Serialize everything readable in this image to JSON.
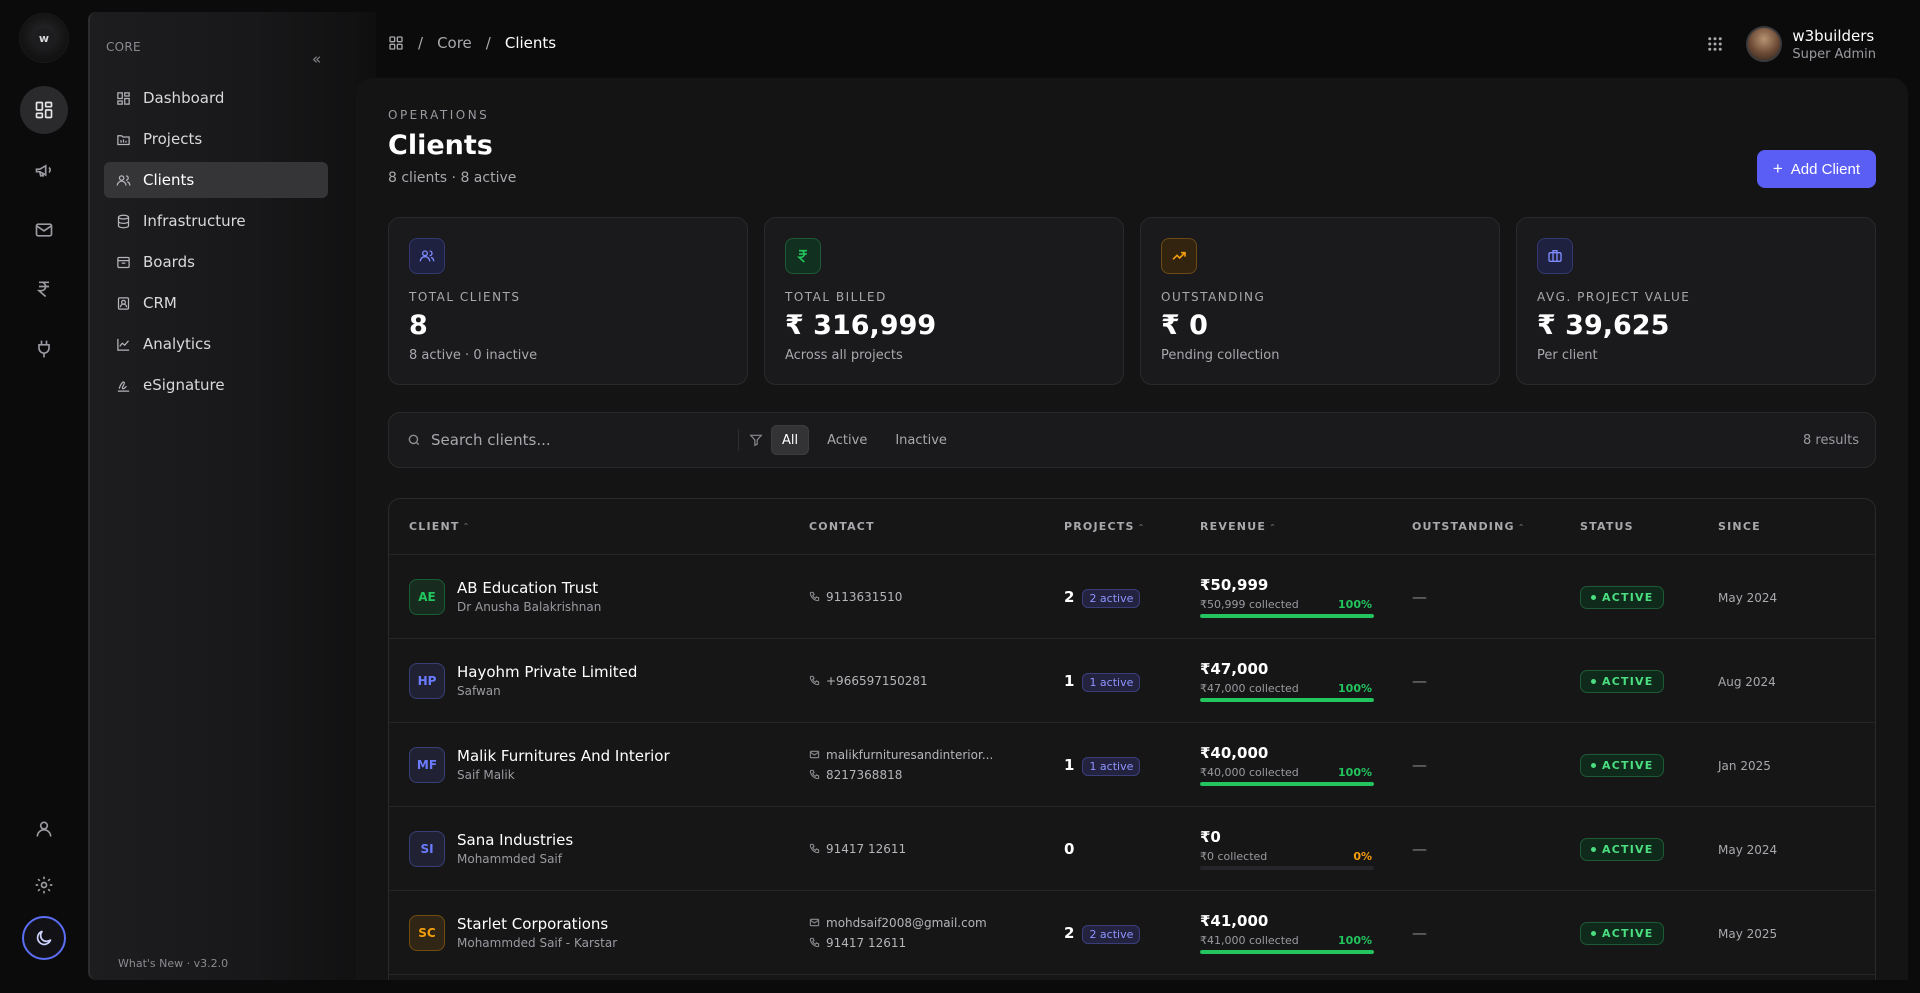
{
  "rail": {
    "logo_letter": "w",
    "items": [
      {
        "name": "dashboard-grid-icon",
        "active": true
      },
      {
        "name": "megaphone-icon",
        "active": false
      },
      {
        "name": "mail-icon",
        "active": false
      },
      {
        "name": "rupee-icon",
        "active": false
      },
      {
        "name": "plug-icon",
        "active": false
      }
    ],
    "bottom": [
      "user-icon",
      "settings-icon",
      "moon-icon"
    ]
  },
  "sidenav": {
    "section_label": "CORE",
    "collapse_icon": "«",
    "items": [
      {
        "label": "Dashboard",
        "icon": "dashboard-icon"
      },
      {
        "label": "Projects",
        "icon": "projects-icon"
      },
      {
        "label": "Clients",
        "icon": "users-icon",
        "active": true
      },
      {
        "label": "Infrastructure",
        "icon": "database-icon"
      },
      {
        "label": "Boards",
        "icon": "boards-icon"
      },
      {
        "label": "CRM",
        "icon": "contact-book-icon"
      },
      {
        "label": "Analytics",
        "icon": "line-chart-icon"
      },
      {
        "label": "eSignature",
        "icon": "signature-icon"
      }
    ],
    "footer": "What's New · v3.2.0"
  },
  "breadcrumb": {
    "sep1": "/",
    "core": "Core",
    "sep2": "/",
    "current": "Clients"
  },
  "user": {
    "name": "w3builders",
    "role": "Super Admin"
  },
  "page": {
    "eyebrow": "OPERATIONS",
    "title": "Clients",
    "subtitle": "8 clients · 8 active",
    "add_button": "Add Client",
    "add_plus": "+"
  },
  "stats": [
    {
      "label": "TOTAL CLIENTS",
      "value": "8",
      "sub": "8 active · 0 inactive",
      "icon": "users-icon",
      "color": "#6b7bff"
    },
    {
      "label": "TOTAL BILLED",
      "value": "₹ 316,999",
      "sub": "Across all projects",
      "icon": "rupee-icon",
      "color": "#22c55e"
    },
    {
      "label": "OUTSTANDING",
      "value": "₹ 0",
      "sub": "Pending collection",
      "icon": "trending-up-icon",
      "color": "#f59e0b"
    },
    {
      "label": "AVG. PROJECT VALUE",
      "value": "₹ 39,625",
      "sub": "Per client",
      "icon": "briefcase-icon",
      "color": "#6b7bff"
    }
  ],
  "toolbar": {
    "search_placeholder": "Search clients...",
    "filters": [
      "All",
      "Active",
      "Inactive"
    ],
    "active_filter": "All",
    "results": "8 results"
  },
  "table": {
    "headers": {
      "client": "CLIENT",
      "contact": "CONTACT",
      "projects": "PROJECTS",
      "revenue": "REVENUE",
      "outstanding": "OUTSTANDING",
      "status": "STATUS",
      "since": "SINCE"
    },
    "sort_caret": "⌃",
    "rows": [
      {
        "initials": "AE",
        "color": "#22c55e",
        "name": "AB Education Trust",
        "contact_name": "Dr Anusha Balakrishnan",
        "email": "",
        "phone": "9113631510",
        "projects": "2",
        "badge": "2 active",
        "revenue": "₹50,999",
        "collected": "₹50,999 collected",
        "pct_label": "100%",
        "pct": 100,
        "outstanding": "—",
        "status": "ACTIVE",
        "since": "May 2024"
      },
      {
        "initials": "HP",
        "color": "#6b7bff",
        "name": "Hayohm Private Limited",
        "contact_name": "Safwan",
        "email": "",
        "phone": "+966597150281",
        "projects": "1",
        "badge": "1 active",
        "revenue": "₹47,000",
        "collected": "₹47,000 collected",
        "pct_label": "100%",
        "pct": 100,
        "outstanding": "—",
        "status": "ACTIVE",
        "since": "Aug 2024"
      },
      {
        "initials": "MF",
        "color": "#6b7bff",
        "name": "Malik Furnitures And Interior",
        "contact_name": "Saif Malik",
        "email": "malikfurnituresandinterior...",
        "phone": "8217368818",
        "projects": "1",
        "badge": "1 active",
        "revenue": "₹40,000",
        "collected": "₹40,000 collected",
        "pct_label": "100%",
        "pct": 100,
        "outstanding": "—",
        "status": "ACTIVE",
        "since": "Jan 2025"
      },
      {
        "initials": "SI",
        "color": "#6b7bff",
        "name": "Sana Industries",
        "contact_name": "Mohammded Saif",
        "email": "",
        "phone": "91417 12611",
        "projects": "0",
        "badge": "",
        "revenue": "₹0",
        "collected": "₹0 collected",
        "pct_label": "0%",
        "pct": 0,
        "outstanding": "—",
        "status": "ACTIVE",
        "since": "May 2024"
      },
      {
        "initials": "SC",
        "color": "#f59e0b",
        "name": "Starlet Corporations",
        "contact_name": "Mohammded Saif - Karstar",
        "email": "mohdsaif2008@gmail.com",
        "phone": "91417 12611",
        "projects": "2",
        "badge": "2 active",
        "revenue": "₹41,000",
        "collected": "₹41,000 collected",
        "pct_label": "100%",
        "pct": 100,
        "outstanding": "—",
        "status": "ACTIVE",
        "since": "May 2025"
      }
    ]
  }
}
